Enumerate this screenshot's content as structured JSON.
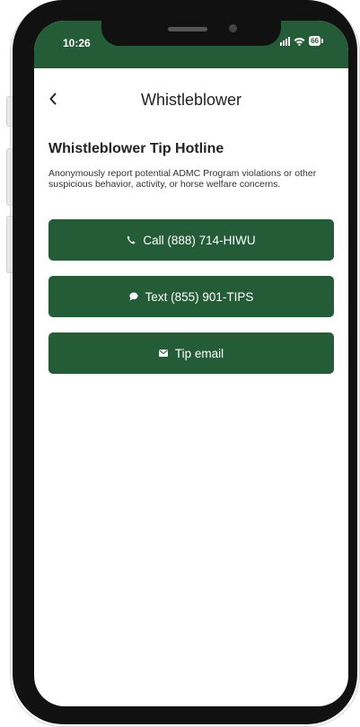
{
  "status_bar": {
    "time": "10:26",
    "battery": "66"
  },
  "header": {
    "back_icon": "chevron-left-icon",
    "title": "Whistleblower"
  },
  "main": {
    "section_title": "Whistleblower Tip Hotline",
    "description": "Anonymously report potential ADMC Program violations or other suspicious behavior, activity, or horse welfare concerns.",
    "buttons": [
      {
        "label": "Call (888) 714-HIWU",
        "icon": "phone-icon"
      },
      {
        "label": "Text (855) 901-TIPS",
        "icon": "chat-bubble-icon"
      },
      {
        "label": "Tip email",
        "icon": "envelope-icon"
      }
    ]
  },
  "colors": {
    "brand": "#255c38",
    "text": "#222222",
    "background": "#ffffff"
  }
}
